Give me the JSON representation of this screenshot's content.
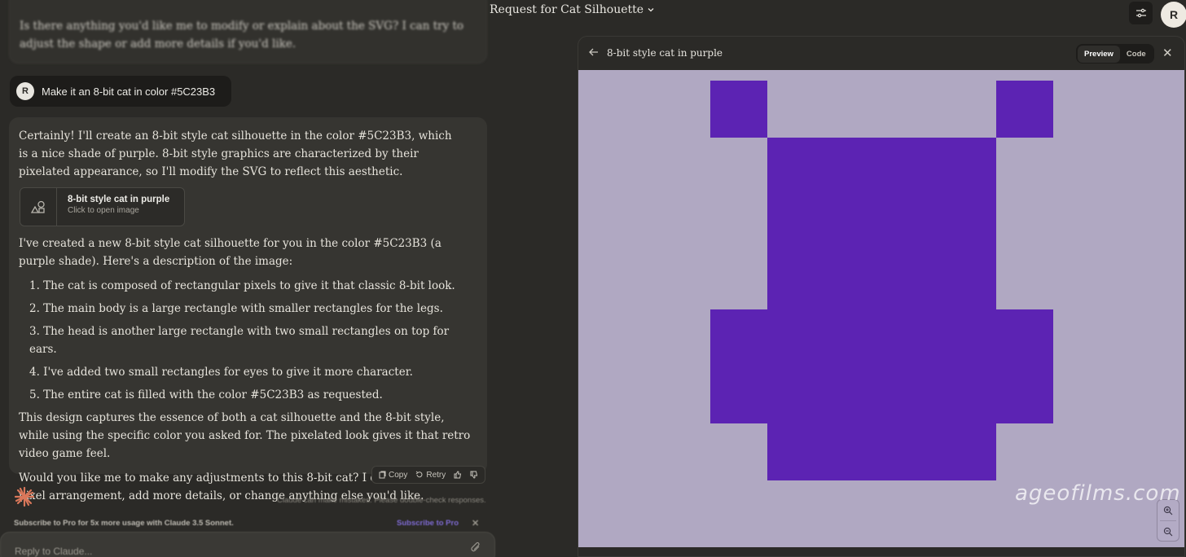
{
  "header": {
    "title": "Request for Cat Silhouette",
    "avatar_initial": "R"
  },
  "chat": {
    "previous_message": "Is there anything you'd like me to modify or explain about the SVG? I can try to adjust the shape or add more details if you'd like.",
    "user_message": {
      "avatar_initial": "R",
      "text": "Make it an 8-bit cat in color #5C23B3"
    },
    "assistant": {
      "intro": "Certainly! I'll create an 8-bit style cat silhouette in the color #5C23B3, which is a nice shade of purple. 8-bit style graphics are characterized by their pixelated appearance, so I'll modify the SVG to reflect this aesthetic.",
      "artifact_card": {
        "title": "8-bit style cat in purple",
        "subtitle": "Click to open image",
        "icon": "shapes-icon"
      },
      "description_intro": "I've created a new 8-bit style cat silhouette for you in the color #5C23B3 (a purple shade). Here's a description of the image:",
      "list_items": [
        "1. The cat is composed of rectangular pixels to give it that classic 8-bit look.",
        "2. The main body is a large rectangle with smaller rectangles for the legs.",
        "3. The head is another large rectangle with two small rectangles on top for ears.",
        "4. I've added two small rectangles for eyes to give it more character.",
        "5. The entire cat is filled with the color #5C23B3 as requested."
      ],
      "summary": "This design captures the essence of both a cat silhouette and the 8-bit style, while using the specific color you asked for. The pixelated look gives it that retro video game feel.",
      "closing": "Would you like me to make any adjustments to this 8-bit cat? I can modify the pixel arrangement, add more details, or change anything else you'd like."
    },
    "actions": {
      "copy_label": "Copy",
      "retry_label": "Retry"
    },
    "disclaimer": "Claude can make mistakes. Please double-check responses.",
    "subscribe_text": "Subscribe to Pro for 5x more usage with Claude 3.5 Sonnet.",
    "subscribe_link": "Subscribe to Pro",
    "reply_placeholder": "Reply to Claude..."
  },
  "artifact_panel": {
    "title": "8-bit style cat in purple",
    "tabs": [
      "Preview",
      "Code"
    ],
    "active_tab": "Preview",
    "canvas_background": "#b0a8c2",
    "cat_color": "#5C23B3",
    "watermark": "ageofilms.com"
  }
}
